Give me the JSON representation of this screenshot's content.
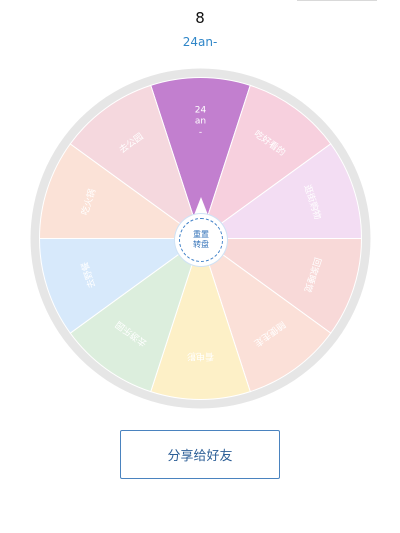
{
  "counter": "8",
  "result": "24an-",
  "wheel": {
    "segments": [
      {
        "label": "24\nan\n-",
        "color": "#c27fcf",
        "angle": -90
      },
      {
        "label": "吃好看的",
        "color": "#f7d0de",
        "angle": -54
      },
      {
        "label": "逛街购物",
        "color": "#f3ddf3",
        "angle": -18
      },
      {
        "label": "回家睡觉",
        "color": "#f8d9d8",
        "angle": 18
      },
      {
        "label": "随便走走",
        "color": "#fbe0d8",
        "angle": 54
      },
      {
        "label": "看电影",
        "color": "#fdf0c7",
        "angle": 90
      },
      {
        "label": "去游乐园",
        "color": "#dceedd",
        "angle": 126
      },
      {
        "label": "去野餐",
        "color": "#d7e9fb",
        "angle": 162
      },
      {
        "label": "吃火锅",
        "color": "#fbe2d7",
        "angle": 198
      },
      {
        "label": "去公园",
        "color": "#f5d8de",
        "angle": 234
      }
    ],
    "rim_color": "#e6e6e6",
    "center": {
      "line1": "重置",
      "line2": "转盘"
    }
  },
  "share_button": "分享给好友"
}
